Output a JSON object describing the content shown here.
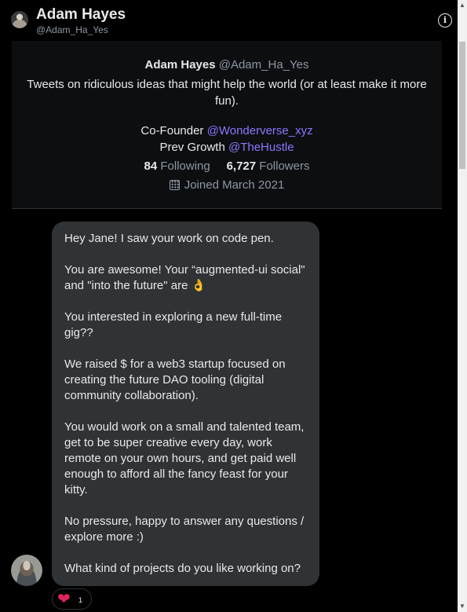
{
  "header": {
    "name": "Adam Hayes",
    "handle": "@Adam_Ha_Yes",
    "info_icon": "i"
  },
  "profile": {
    "name": "Adam Hayes",
    "handle": "@Adam_Ha_Yes",
    "bio": "Tweets on ridiculous ideas that might help the world (or at least make it more fun).",
    "cofounder_prefix": "Co-Founder",
    "cofounder_link": "@Wonderverse_xyz",
    "prev_prefix": "Prev Growth",
    "prev_link": "@TheHustle",
    "following_count": "84",
    "following_label": "Following",
    "followers_count": "6,727",
    "followers_label": "Followers",
    "joined": "Joined March 2021",
    "calendar_icon": "calendar-icon",
    "link_color": "#8b77ff"
  },
  "message": {
    "p1": "Hey Jane! I saw your work on code pen.",
    "p2": "You are awesome! Your “augmented-ui social\" and \"into the future\" are 👌",
    "p3": "You interested in exploring a new full-time gig??",
    "p4": "We raised $ for a web3 startup focused on creating the future DAO tooling (digital community collaboration).",
    "p5": "You would work on a small and talented team, get to be super creative every day, work remote on your own hours, and get paid well enough to afford all the fancy feast for your kitty.",
    "p6": "No pressure, happy to answer any questions / explore more :)",
    "p7": "What kind of projects do you like working on?"
  },
  "reaction": {
    "icon": "❤",
    "count": "1",
    "color": "#e0245e"
  },
  "scrollbar": {
    "up": "▲",
    "down": "▼"
  }
}
